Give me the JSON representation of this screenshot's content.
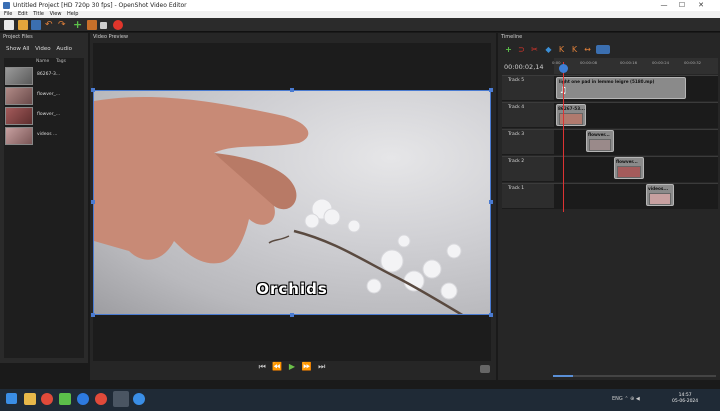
{
  "window": {
    "title": "Untitled Project [HD 720p 30 fps] - OpenShot Video Editor",
    "minimize": "—",
    "maximize": "☐",
    "close": "✕"
  },
  "menu": [
    "File",
    "Edit",
    "Title",
    "View",
    "Help"
  ],
  "project_files": {
    "title": "Project Files",
    "tabs": [
      "Show All",
      "Video",
      "Audio"
    ],
    "columns": [
      "Name",
      "Tags"
    ],
    "files": [
      {
        "name": "86267-3..."
      },
      {
        "name": "flowver_..."
      },
      {
        "name": "flowver_..."
      },
      {
        "name": "videos ..."
      }
    ]
  },
  "preview": {
    "title": "Video Preview",
    "caption": "Orchids"
  },
  "timeline": {
    "title": "Timeline",
    "timecode": "00:00:02,14",
    "ruler_ticks": [
      "0:00",
      "00:00:08",
      "00:00:16",
      "00:00:24",
      "00:00:32"
    ],
    "tracks": [
      {
        "name": "Track 5",
        "clip": "light one pad in lemmo leigre (5180.mp)"
      },
      {
        "name": "Track 4",
        "clip": "86267-53..."
      },
      {
        "name": "Track 3",
        "clip": "flowver..."
      },
      {
        "name": "Track 2",
        "clip": "flowver..."
      },
      {
        "name": "Track 1",
        "clip": "videos..."
      }
    ]
  },
  "taskbar": {
    "time": "14:57",
    "date": "05-06-2024",
    "tray": "ENG ⌃ ⊕ ◀"
  },
  "colors": {
    "accent": "#4a7bd1",
    "playhead": "#dd3333",
    "background": "#1a1a1a"
  }
}
